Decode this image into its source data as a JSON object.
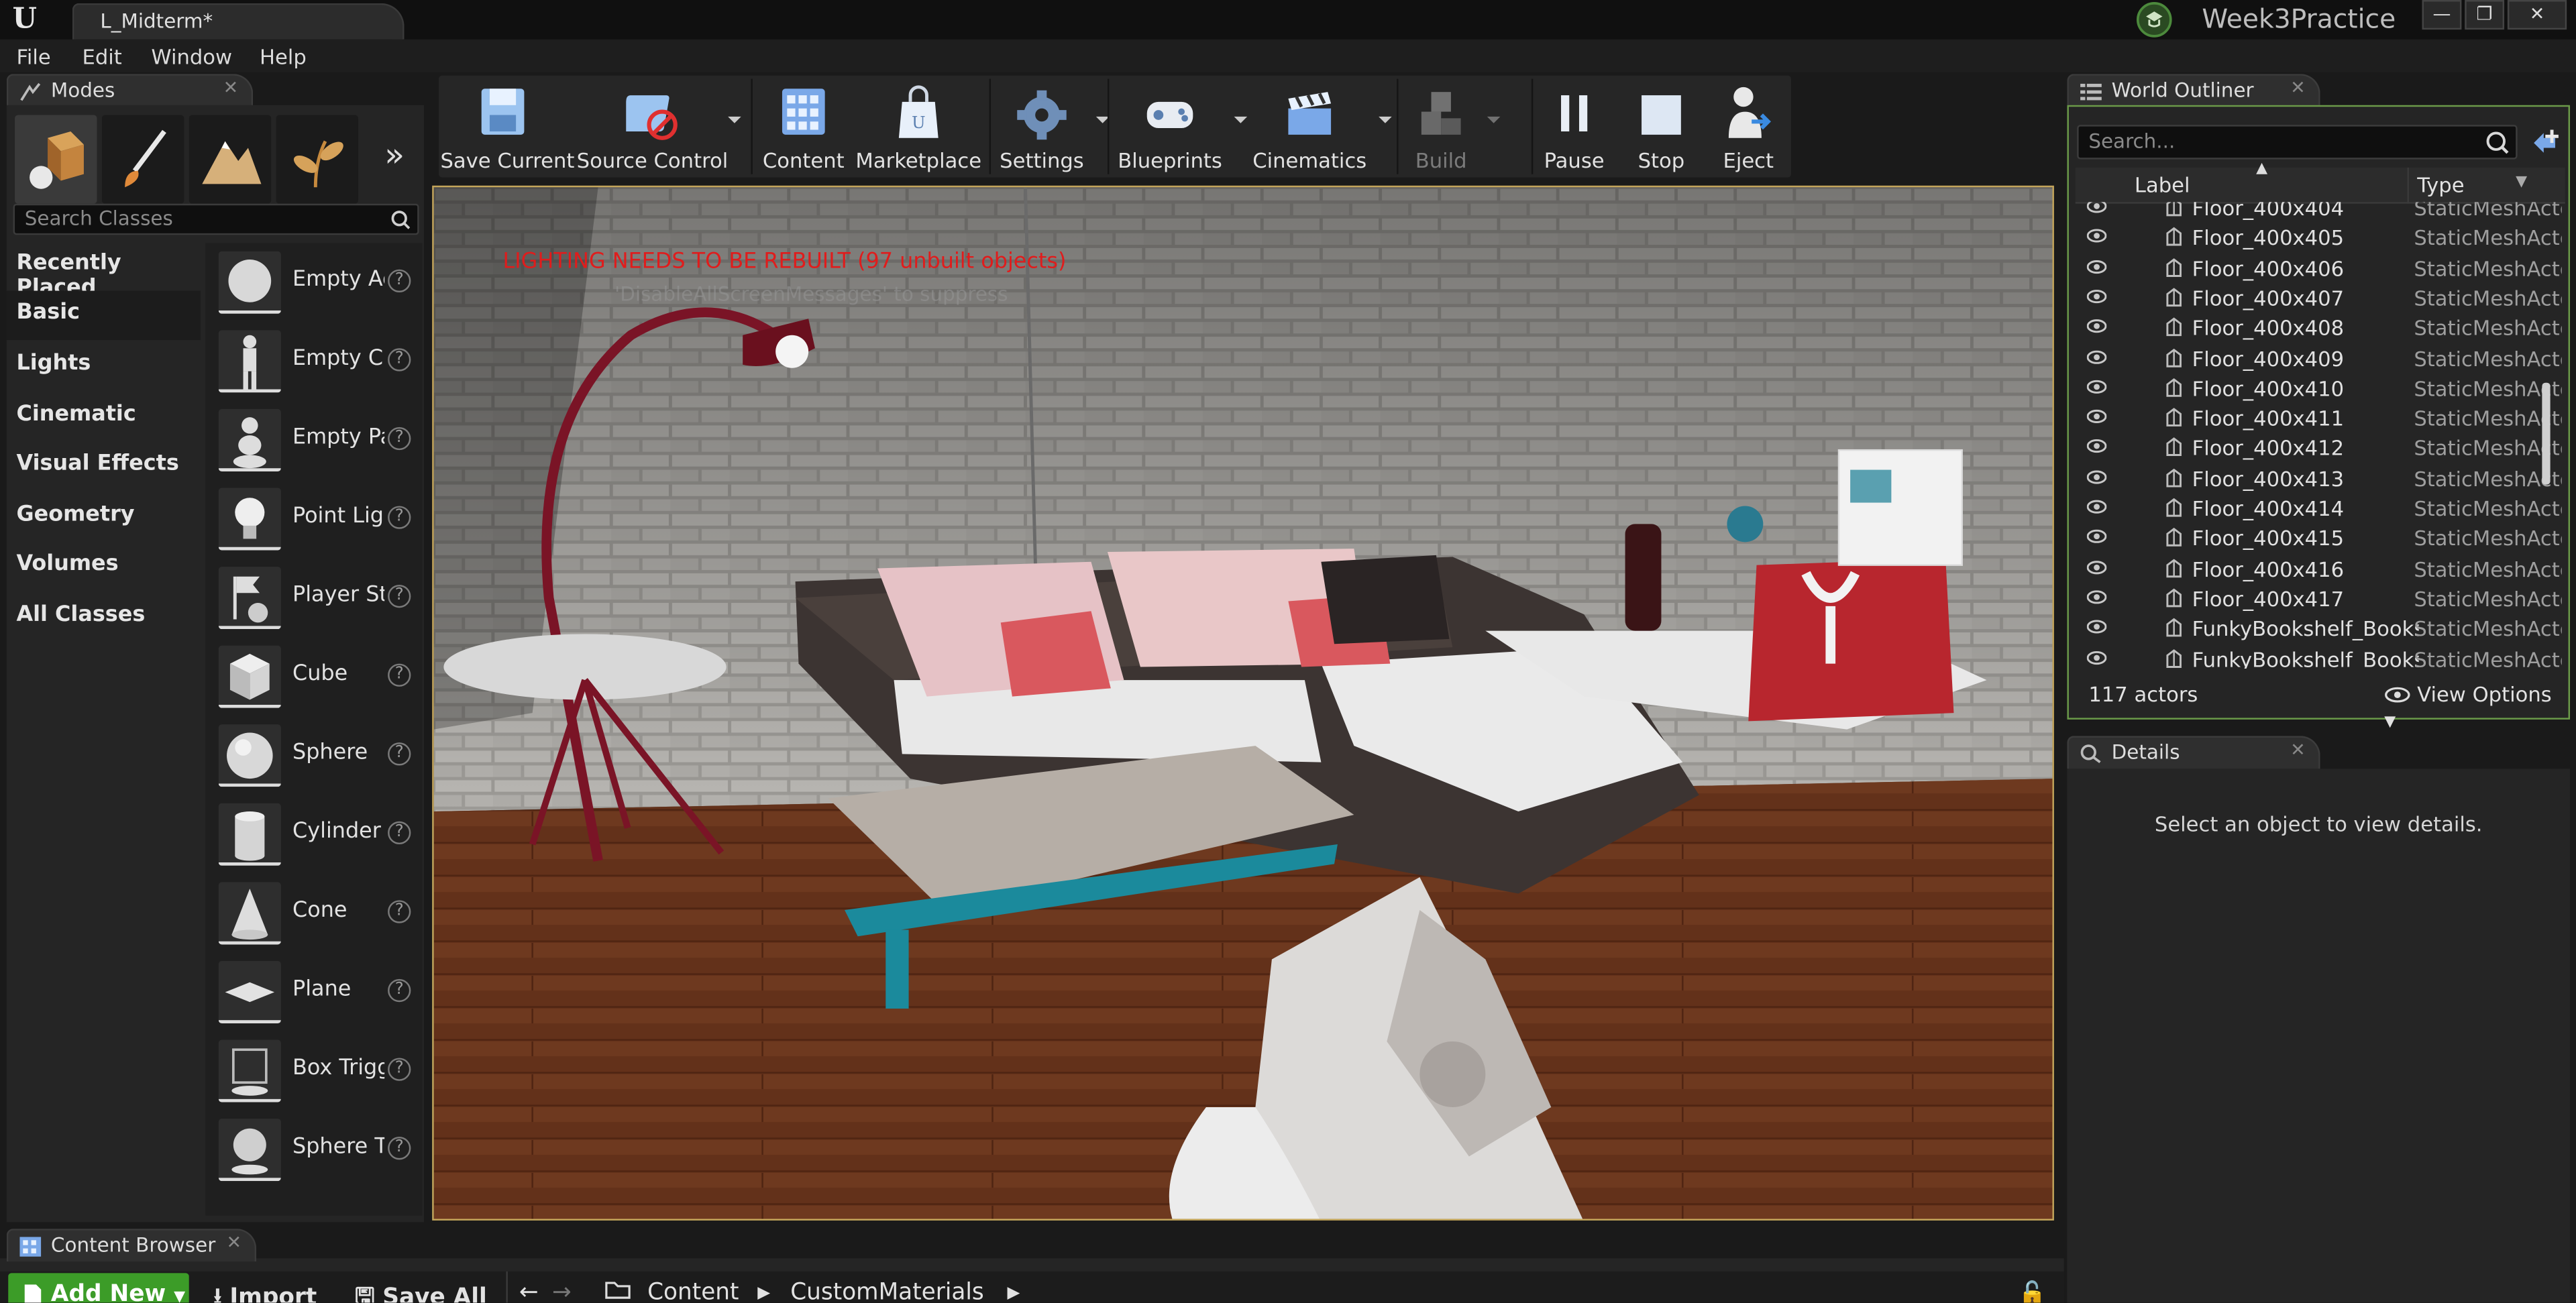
{
  "window": {
    "tab_title": "L_Midterm*",
    "project_name": "Week3Practice",
    "controls": [
      "—",
      "❐",
      "✕"
    ]
  },
  "menu": [
    "File",
    "Edit",
    "Window",
    "Help"
  ],
  "modes": {
    "tab_label": "Modes",
    "search_placeholder": "Search Classes",
    "categories": [
      "Recently Placed",
      "Basic",
      "Lights",
      "Cinematic",
      "Visual Effects",
      "Geometry",
      "Volumes",
      "All Classes"
    ],
    "active_category": "Basic",
    "items": [
      "Empty Actor",
      "Empty Character",
      "Empty Pawn",
      "Point Light",
      "Player Start",
      "Cube",
      "Sphere",
      "Cylinder",
      "Cone",
      "Plane",
      "Box Trigger",
      "Sphere Trigger"
    ],
    "help_glyph": "?"
  },
  "toolbar": {
    "buttons": [
      "Save Current",
      "Source Control",
      "Content",
      "Marketplace",
      "Settings",
      "Blueprints",
      "Cinematics",
      "Build",
      "Pause",
      "Stop",
      "Eject"
    ]
  },
  "viewport": {
    "warning": "LIGHTING NEEDS TO BE REBUILT (97 unbuilt objects)",
    "hint": "'DisableAllScreenMessages' to suppress"
  },
  "outliner": {
    "tab_label": "World Outliner",
    "search_placeholder": "Search...",
    "col_label": "Label",
    "col_type": "Type",
    "rows": [
      {
        "label": "Floor_400x404",
        "type": "StaticMeshActor"
      },
      {
        "label": "Floor_400x405",
        "type": "StaticMeshActor"
      },
      {
        "label": "Floor_400x406",
        "type": "StaticMeshActor"
      },
      {
        "label": "Floor_400x407",
        "type": "StaticMeshActor"
      },
      {
        "label": "Floor_400x408",
        "type": "StaticMeshActor"
      },
      {
        "label": "Floor_400x409",
        "type": "StaticMeshActor"
      },
      {
        "label": "Floor_400x410",
        "type": "StaticMeshActor"
      },
      {
        "label": "Floor_400x411",
        "type": "StaticMeshActor"
      },
      {
        "label": "Floor_400x412",
        "type": "StaticMeshActor"
      },
      {
        "label": "Floor_400x413",
        "type": "StaticMeshActor"
      },
      {
        "label": "Floor_400x414",
        "type": "StaticMeshActor"
      },
      {
        "label": "Floor_400x415",
        "type": "StaticMeshActor"
      },
      {
        "label": "Floor_400x416",
        "type": "StaticMeshActor"
      },
      {
        "label": "Floor_400x417",
        "type": "StaticMeshActor"
      },
      {
        "label": "FunkyBookshelf_Bookshelf",
        "type": "StaticMeshActor"
      },
      {
        "label": "FunkyBookshelf_Bookshelf",
        "type": "StaticMeshActor"
      }
    ],
    "actor_count": "117 actors",
    "view_options": "View Options"
  },
  "details": {
    "tab_label": "Details",
    "empty_message": "Select an object to view details."
  },
  "content_browser": {
    "tab_label": "Content Browser",
    "add_new": "Add New",
    "import": "Import",
    "save_all": "Save All",
    "breadcrumb": [
      "Content",
      "CustomMaterials"
    ]
  },
  "colors": {
    "accent_green": "#3c9c28",
    "warning_red": "#e01c1c",
    "viewport_border": "#c3a55a"
  }
}
